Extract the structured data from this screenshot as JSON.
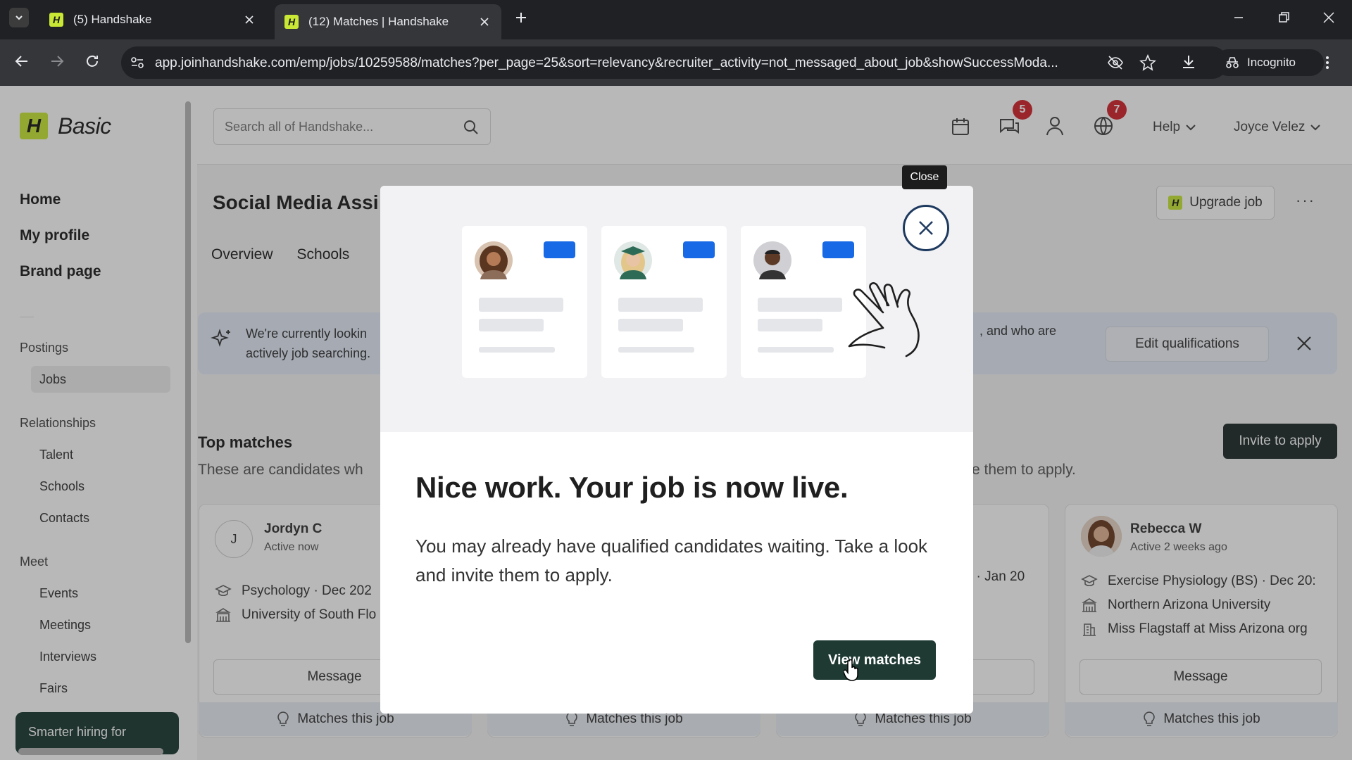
{
  "browser": {
    "tabs": [
      {
        "title": "(5) Handshake",
        "active": false
      },
      {
        "title": "(12) Matches | Handshake",
        "active": true
      }
    ],
    "url": "app.joinhandshake.com/emp/jobs/10259588/matches?per_page=25&sort=relevancy&recruiter_activity=not_messaged_about_job&showSuccessModa...",
    "incognito_label": "Incognito"
  },
  "app": {
    "logo_letter": "H",
    "logo_text": "Basic",
    "search_placeholder": "Search all of Handshake...",
    "messages_badge": "5",
    "notifications_badge": "7",
    "help_label": "Help",
    "user_name": "Joyce Velez"
  },
  "sidebar": {
    "main_items": [
      "Home",
      "My profile",
      "Brand page"
    ],
    "sections": [
      {
        "title": "Postings",
        "items": [
          "Jobs"
        ]
      },
      {
        "title": "Relationships",
        "items": [
          "Talent",
          "Schools",
          "Contacts"
        ]
      },
      {
        "title": "Meet",
        "items": [
          "Events",
          "Meetings",
          "Interviews",
          "Fairs"
        ]
      }
    ],
    "promo": "Smarter hiring for"
  },
  "job": {
    "title": "Social Media Assi",
    "tabs": [
      "Overview",
      "Schools"
    ],
    "upgrade_label": "Upgrade job",
    "more_label": "···"
  },
  "banner": {
    "text_left_1": "We're currently lookin",
    "text_left_2": "actively job searching.",
    "text_right": ", and who are",
    "edit_label": "Edit qualifications"
  },
  "top_matches": {
    "title": "Top matches",
    "subtitle_left": "These are candidates wh",
    "subtitle_right": "e them to apply.",
    "invite_label": "Invite to apply",
    "cards": [
      {
        "initial": "J",
        "name": "Jordyn C",
        "activity": "Active now",
        "degree": "Psychology · Dec 202",
        "school": "University of South Flo",
        "message_label": "Message",
        "footer": "Matches this job"
      },
      {
        "footer": "Matches this job"
      },
      {
        "degree_fragment": "s\" · Jan 20",
        "footer": "Matches this job"
      },
      {
        "name": "Rebecca W",
        "activity": "Active 2 weeks ago",
        "degree": "Exercise Physiology (BS) · Dec 20:",
        "school": "Northern Arizona University",
        "org": "Miss Flagstaff at Miss Arizona org",
        "message_label": "Message",
        "footer": "Matches this job"
      }
    ]
  },
  "modal": {
    "close_tooltip": "Close",
    "title": "Nice work. Your job is now live.",
    "body": "You may already have qualified candidates waiting. Take a look and invite them to apply.",
    "cta_label": "View matches"
  },
  "colors": {
    "accent_lime": "#c8e835",
    "cta_dark_green": "#1e3a33",
    "banner_blue": "#e3ebf8",
    "badge_red": "#d3262e",
    "illustration_blue": "#1769e6"
  }
}
